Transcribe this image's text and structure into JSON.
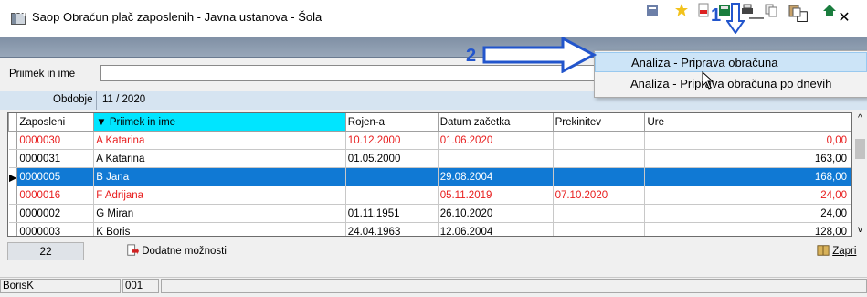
{
  "window": {
    "title": "Saop Obračun plač zaposlenih - Javna ustanova - Šola",
    "minimize": "—",
    "maximize": "☐",
    "close": "✕"
  },
  "header": {
    "title": "Priprava obračuna"
  },
  "filter": {
    "label": "Priimek in ime",
    "value": ""
  },
  "period": {
    "label": "Obdobje",
    "value": "11 / 2020"
  },
  "table": {
    "columns": [
      "Zaposleni",
      "▼ Priimek in ime",
      "Rojen-a",
      "Datum začetka",
      "Prekinitev",
      "Ure"
    ],
    "rows": [
      {
        "id": "0000030",
        "name": "A Katarina",
        "born": "10.12.2000",
        "start": "01.06.2020",
        "end": "",
        "hours": "0,00",
        "style": "red"
      },
      {
        "id": "0000031",
        "name": "A Katarina",
        "born": "01.05.2000",
        "start": "",
        "end": "",
        "hours": "163,00",
        "style": ""
      },
      {
        "id": "0000005",
        "name": "B Jana",
        "born": "",
        "start": "29.08.2004",
        "end": "",
        "hours": "168,00",
        "style": "sel"
      },
      {
        "id": "0000016",
        "name": "F Adrijana",
        "born": "",
        "start": "05.11.2019",
        "end": "07.10.2020",
        "hours": "24,00",
        "style": "red"
      },
      {
        "id": "0000002",
        "name": "G Miran",
        "born": "01.11.1951",
        "start": "26.10.2020",
        "end": "",
        "hours": "24,00",
        "style": ""
      },
      {
        "id": "0000003",
        "name": "K Boris",
        "born": "24.04.1963",
        "start": "12.06.2004",
        "end": "",
        "hours": "128,00",
        "style": ""
      }
    ]
  },
  "footer": {
    "count": "22",
    "more_label": "Dodatne možnosti",
    "close_label": "Zapri"
  },
  "status": {
    "user": "BorisK",
    "code": "001"
  },
  "menu": {
    "items": [
      "Analiza - Priprava obračuna",
      "Analiza - Priprava obračuna po dnevih"
    ]
  },
  "annotations": {
    "step1": "1",
    "step2": "2"
  },
  "colors": {
    "header": "#8796a9",
    "selection": "#1079d4",
    "warning_text": "#e81c1c",
    "sort_column": "#00e5ff",
    "annotation": "#2255cc"
  }
}
